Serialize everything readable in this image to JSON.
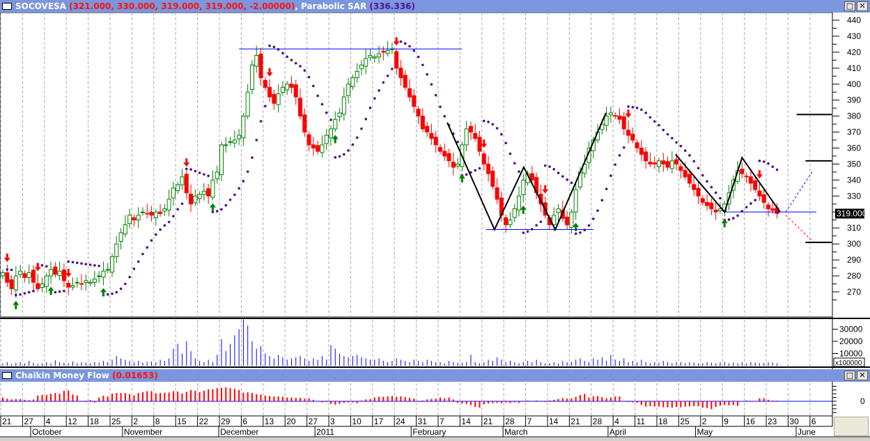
{
  "main_panel": {
    "symbol": "SOCOVESA",
    "ohlc_readout": "(321.000, 330.000, 319.000, 319.000, -2.00000)",
    "indicator": "Parabolic SAR",
    "indicator_value": "(336.336)"
  },
  "volume_panel": {
    "multiplier_label": "x100000",
    "ticks": [
      "30000",
      "20000",
      "10000"
    ]
  },
  "cmf_panel": {
    "title": "Chaikin Money Flow",
    "value": "(0.01653)",
    "zero_label": "0"
  },
  "window_buttons": {
    "restore": "□",
    "close": "✕"
  },
  "last_price_label": "319.000",
  "colors": {
    "up": "#008000",
    "down": "#ff0000",
    "sar": "#4b0f82",
    "volume": "#0000ff",
    "cmf": "#ff0000",
    "zero_line": "#0000ff",
    "title_bar": "#7b96dc"
  },
  "chart_data": {
    "type": "candlestick",
    "title": "SOCOVESA",
    "ylim": [
      260,
      445
    ],
    "yticks": [
      270,
      280,
      290,
      300,
      310,
      320,
      330,
      340,
      350,
      360,
      370,
      380,
      390,
      400,
      410,
      420,
      430,
      440
    ],
    "closes": [
      282,
      276,
      272,
      280,
      283,
      279,
      282,
      276,
      272,
      275,
      280,
      284,
      281,
      283,
      277,
      273,
      274,
      276,
      275,
      277,
      276,
      278,
      280,
      283,
      284,
      292,
      300,
      307,
      312,
      318,
      315,
      318,
      320,
      319,
      318,
      320,
      319,
      322,
      328,
      335,
      337,
      342,
      332,
      325,
      330,
      331,
      333,
      330,
      340,
      345,
      362,
      362,
      364,
      365,
      368,
      380,
      395,
      412,
      418,
      404,
      398,
      392,
      388,
      394,
      398,
      400,
      398,
      392,
      380,
      370,
      362,
      360,
      358,
      362,
      368,
      372,
      378,
      382,
      392,
      400,
      404,
      408,
      412,
      416,
      418,
      417,
      419,
      420,
      421,
      422,
      410,
      404,
      398,
      392,
      386,
      380,
      372,
      370,
      366,
      362,
      358,
      355,
      352,
      348,
      350,
      362,
      372,
      370,
      366,
      358,
      350,
      344,
      336,
      328,
      318,
      312,
      315,
      322,
      330,
      340,
      344,
      340,
      332,
      325,
      318,
      312,
      318,
      322,
      316,
      312,
      320,
      334,
      345,
      350,
      360,
      365,
      370,
      375,
      380,
      382,
      380,
      378,
      372,
      368,
      365,
      360,
      356,
      352,
      350,
      350,
      352,
      350,
      348,
      352,
      350,
      346,
      342,
      338,
      334,
      330,
      326,
      324,
      322,
      320,
      322,
      325,
      332,
      340,
      346,
      344,
      342,
      338,
      334,
      330,
      326,
      322,
      321,
      319
    ],
    "volume": [
      2000,
      3000,
      1500,
      2500,
      3000,
      2000,
      4000,
      2500,
      1500,
      2000,
      3000,
      2000,
      4500,
      3000,
      2500,
      2000,
      3500,
      2000,
      3000,
      2500,
      2000,
      3000,
      2500,
      4000,
      3000,
      5000,
      8000,
      6000,
      5000,
      4000,
      3000,
      4000,
      2500,
      3000,
      3500,
      3000,
      5000,
      4000,
      6000,
      14000,
      18000,
      10000,
      20000,
      12000,
      6000,
      4000,
      3000,
      5000,
      3000,
      9000,
      22000,
      12000,
      18000,
      25000,
      30000,
      38000,
      33000,
      20000,
      14000,
      16000,
      10000,
      8000,
      6000,
      9000,
      7000,
      5000,
      6000,
      7000,
      8000,
      6000,
      4000,
      6000,
      5000,
      8000,
      5000,
      17000,
      14000,
      10000,
      8000,
      7000,
      8000,
      9000,
      7000,
      6000,
      5000,
      5000,
      6000,
      4000,
      3000,
      4000,
      6000,
      5000,
      4000,
      3000,
      5000,
      4000,
      3000,
      5000,
      4000,
      3000,
      3000,
      2000,
      4000,
      3000,
      2500,
      2500,
      3000,
      9000,
      3000,
      2000,
      3000,
      5000,
      4000,
      7000,
      5000,
      3000,
      4000,
      3000,
      2000,
      3000,
      4000,
      3000,
      5000,
      3000,
      2000,
      2000,
      3000,
      2000,
      4000,
      3000,
      3000,
      5000,
      6000,
      4000,
      3000,
      6000,
      5000,
      7000,
      4000,
      9000,
      5000,
      4000,
      6000,
      3000,
      4000,
      3000,
      5000,
      3000,
      2000,
      3000,
      2500,
      4000,
      3000,
      2000,
      3000,
      3000,
      2000,
      3000,
      2500,
      2000,
      2000,
      3000,
      2500,
      2000,
      3000,
      3000,
      2000,
      2500,
      2000,
      3000,
      2000,
      3000,
      2500,
      2000,
      2500,
      3000,
      2500,
      2000
    ],
    "cmf": [
      0.1,
      0.07,
      0.05,
      0.06,
      0.06,
      0.04,
      0.03,
      0.05,
      0.15,
      0.17,
      0.17,
      0.2,
      0.22,
      0.2,
      0.28,
      0.29,
      0.18,
      0.15,
      0.0,
      -0.02,
      0.03,
      -0.03,
      0.1,
      0.15,
      0.13,
      0.2,
      0.22,
      0.22,
      0.22,
      0.19,
      0.16,
      0.22,
      0.24,
      0.27,
      0.27,
      0.21,
      0.22,
      0.23,
      0.23,
      0.27,
      0.26,
      0.21,
      0.25,
      0.3,
      0.28,
      0.24,
      0.28,
      0.32,
      0.32,
      0.35,
      0.36,
      0.37,
      0.35,
      0.33,
      0.3,
      0.23,
      0.24,
      0.22,
      0.19,
      0.18,
      0.15,
      0.14,
      0.13,
      0.13,
      0.12,
      0.1,
      0.1,
      0.09,
      0.09,
      0.07,
      0.08,
      0.04,
      0.0,
      -0.03,
      -0.02,
      -0.07,
      -0.09,
      -0.07,
      -0.04,
      -0.03,
      -0.03,
      -0.05,
      0.02,
      0.05,
      0.06,
      0.1,
      0.12,
      0.12,
      0.13,
      0.14,
      0.12,
      0.13,
      0.11,
      0.09,
      0.07,
      -0.02,
      0.02,
      0.05,
      0.06,
      0.07,
      0.1,
      0.08,
      0.1,
      0.05,
      -0.04,
      -0.06,
      -0.07,
      -0.1,
      -0.15,
      -0.17,
      -0.08,
      -0.06,
      -0.05,
      -0.04,
      -0.05,
      -0.03,
      -0.05,
      -0.03,
      -0.04,
      0.0,
      0.02,
      0.0,
      0.02,
      0.0,
      -0.02,
      0.02,
      0.04,
      0.06,
      0.08,
      0.07,
      0.08,
      0.12,
      0.17,
      0.2,
      0.1,
      0.13,
      0.14,
      0.11,
      0.08,
      0.1,
      0.13,
      0.13,
      0.0,
      -0.02,
      -0.03,
      -0.04,
      -0.1,
      -0.14,
      -0.13,
      -0.14,
      -0.14,
      -0.16,
      -0.16,
      -0.17,
      -0.15,
      -0.16,
      -0.14,
      -0.14,
      -0.13,
      -0.13,
      -0.17,
      -0.18,
      -0.21,
      -0.15,
      -0.12,
      -0.1,
      -0.11,
      -0.1,
      -0.12,
      0.01,
      0.02,
      0.0,
      -0.01,
      0.08,
      0.08,
      0.04,
      0.02,
      0.017
    ],
    "date_ticks": [
      "21",
      "27",
      "4",
      "12",
      "18",
      "25",
      "2",
      "8",
      "15",
      "22",
      "29",
      "6",
      "13",
      "20",
      "27",
      "3",
      "10",
      "17",
      "24",
      "31",
      "7",
      "14",
      "21",
      "28",
      "7",
      "14",
      "21",
      "28",
      "4",
      "11",
      "18",
      "25",
      "2",
      "9",
      "16",
      "23",
      "30",
      "6"
    ],
    "months": [
      {
        "label": "October",
        "bar": 7
      },
      {
        "label": "November",
        "bar": 28
      },
      {
        "label": "December",
        "bar": 50
      },
      {
        "label": "2011",
        "bar": 72
      },
      {
        "label": "February",
        "bar": 94
      },
      {
        "label": "March",
        "bar": 115
      },
      {
        "label": "April",
        "bar": 139
      },
      {
        "label": "May",
        "bar": 159
      },
      {
        "label": "June",
        "bar": 182
      }
    ],
    "annotations": {
      "resistance": {
        "from": 54,
        "to": 105,
        "price": 422
      },
      "support1": {
        "from": 110.5,
        "to": 135,
        "price": 309
      },
      "support2": {
        "from": 165,
        "to": 186,
        "price": 320
      },
      "zigzag1": [
        [
          101.6,
          376
        ],
        [
          112.4,
          309
        ],
        [
          119.1,
          348
        ],
        [
          126.3,
          309
        ],
        [
          137.9,
          382
        ]
      ],
      "zigzag2": [
        [
          153.8,
          356
        ],
        [
          165,
          320
        ],
        [
          169,
          354
        ],
        [
          177.7,
          320
        ]
      ],
      "projection_up": [
        [
          179,
          320
        ],
        [
          185,
          345
        ]
      ],
      "projection_down": [
        [
          179,
          318
        ],
        [
          185,
          302
        ]
      ],
      "targets": [
        {
          "from": 181.5,
          "to": 189.5,
          "price": 381
        },
        {
          "from": 183.5,
          "to": 189.5,
          "price": 352
        },
        {
          "from": 183.5,
          "to": 189.5,
          "price": 301
        }
      ]
    }
  }
}
